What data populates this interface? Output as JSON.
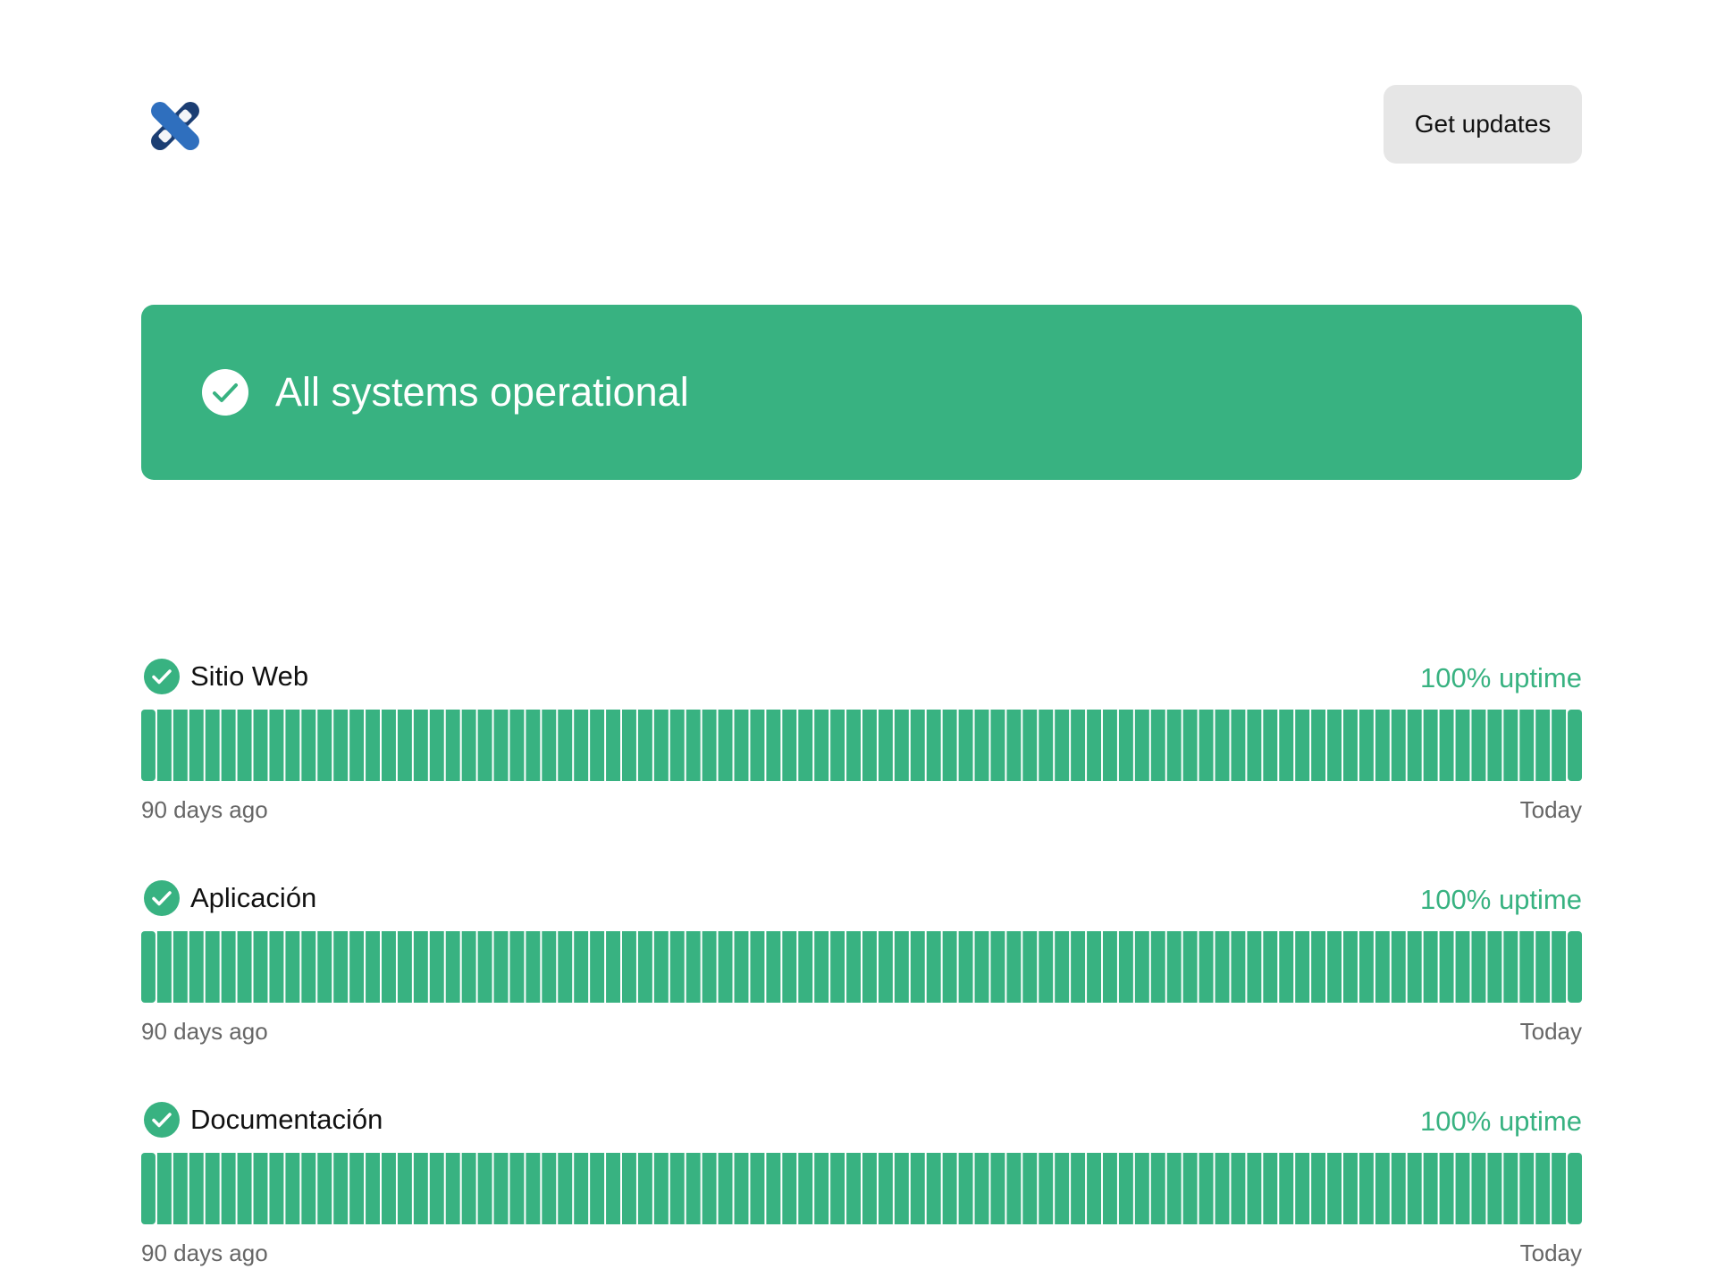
{
  "header": {
    "logo_icon": "crossed-links-logo-icon",
    "get_updates_label": "Get updates"
  },
  "banner": {
    "icon": "check-circle-icon",
    "title": "All systems operational",
    "color": "#38b281"
  },
  "services": [
    {
      "name": "Sitio Web",
      "status_icon": "check-circle-icon",
      "uptime": "100% uptime",
      "days": 90,
      "bar_color": "#38b281",
      "range_start": "90 days ago",
      "range_end": "Today"
    },
    {
      "name": "Aplicación",
      "status_icon": "check-circle-icon",
      "uptime": "100% uptime",
      "days": 90,
      "bar_color": "#38b281",
      "range_start": "90 days ago",
      "range_end": "Today"
    },
    {
      "name": "Documentación",
      "status_icon": "check-circle-icon",
      "uptime": "100% uptime",
      "days": 90,
      "bar_color": "#38b281",
      "range_start": "90 days ago",
      "range_end": "Today"
    }
  ],
  "colors": {
    "success": "#38b281",
    "muted_text": "#666666",
    "button_bg": "#e6e6e6",
    "logo_dark": "#1b3e73",
    "logo_light": "#2f6fbe"
  }
}
